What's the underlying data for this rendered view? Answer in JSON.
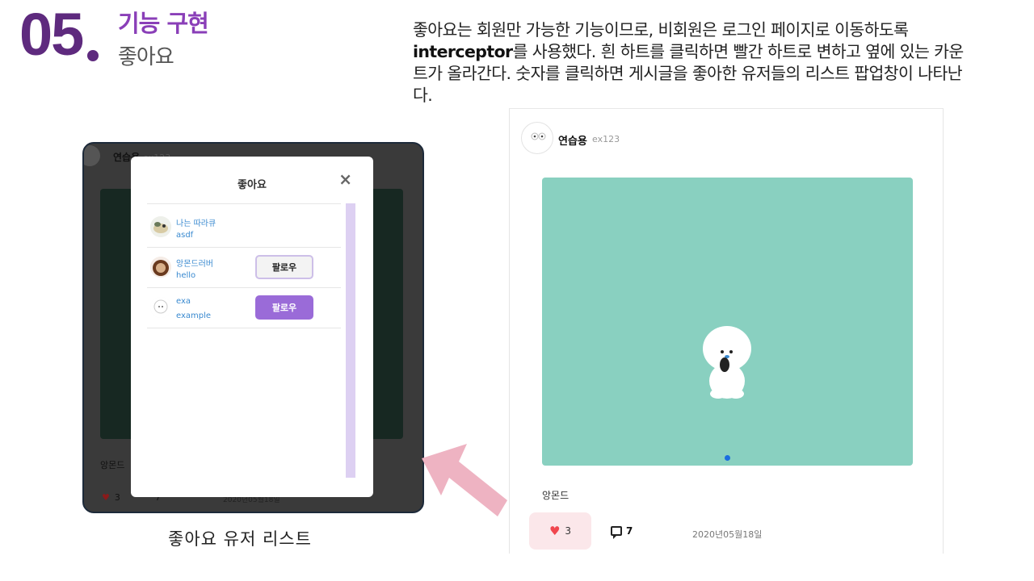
{
  "header": {
    "section_number": "05",
    "title": "기능 구현",
    "subtitle": "좋아요"
  },
  "description": {
    "before": "좋아요는 회원만 가능한 기능이므로, 비회원은 로그인 페이지로 이동하도록 ",
    "keyword": "interceptor",
    "after": "를 사용했다. 흰 하트를 클릭하면 빨간 하트로 변하고 옆에 있는 카운트가 올라간다. 숫자를 클릭하면 게시글을 좋아한 유저들의 리스트 팝업창이 나타난다."
  },
  "left_screenshot": {
    "background_post": {
      "username": "연습용",
      "handle": "ex123",
      "caption": "앙몬드",
      "like_count": "3",
      "comment_count": "7",
      "date": "2020년05월18일"
    },
    "modal": {
      "title": "좋아요",
      "close_glyph": "×",
      "users": [
        {
          "nickname": "나는 따라큐",
          "id": "asdf",
          "button": ""
        },
        {
          "nickname": "앙몬드러버",
          "id": "hello",
          "button": "팔로우"
        },
        {
          "nickname": "exa",
          "id": "example",
          "button": "팔로우"
        }
      ]
    },
    "caption": "좋아요 유저 리스트"
  },
  "post": {
    "username": "연습용",
    "handle": "ex123",
    "caption": "앙몬드",
    "like_count": "3",
    "comment_count": "7",
    "date": "2020년05월18일"
  },
  "colors": {
    "section_purple": "#5e2a7e",
    "title_purple": "#8a3fb8",
    "image_mint": "#89d0c0",
    "like_bg": "#fbe7ea",
    "heart_red": "#f0464e",
    "follow_purple": "#9a6bd8",
    "arrow_pink": "#eeb3c2"
  },
  "icons": [
    "heart-icon",
    "comment-icon",
    "close-icon",
    "arrow-icon"
  ]
}
